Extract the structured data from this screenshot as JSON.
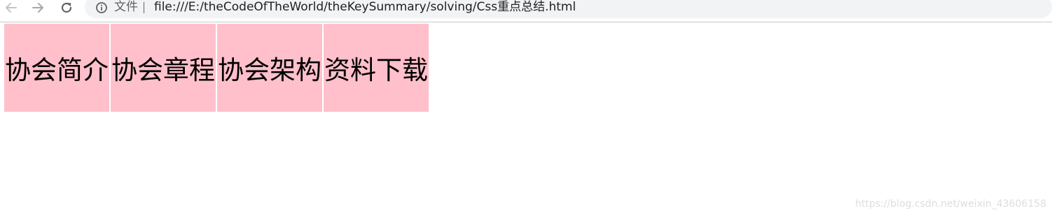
{
  "toolbar": {
    "back_icon": "arrow-left-icon",
    "forward_icon": "arrow-right-icon",
    "reload_icon": "reload-icon",
    "info_icon": "info-icon",
    "scheme_label": "文件",
    "url": "file:///E:/theCodeOfTheWorld/theKeySummary/solving/Css重点总结.html"
  },
  "menu": {
    "background": "#ffc0cb",
    "items": [
      {
        "label": "协会简介"
      },
      {
        "label": "协会章程"
      },
      {
        "label": "协会架构"
      },
      {
        "label": "资料下载"
      }
    ]
  },
  "watermark": "https://blog.csdn.net/weixin_43606158"
}
